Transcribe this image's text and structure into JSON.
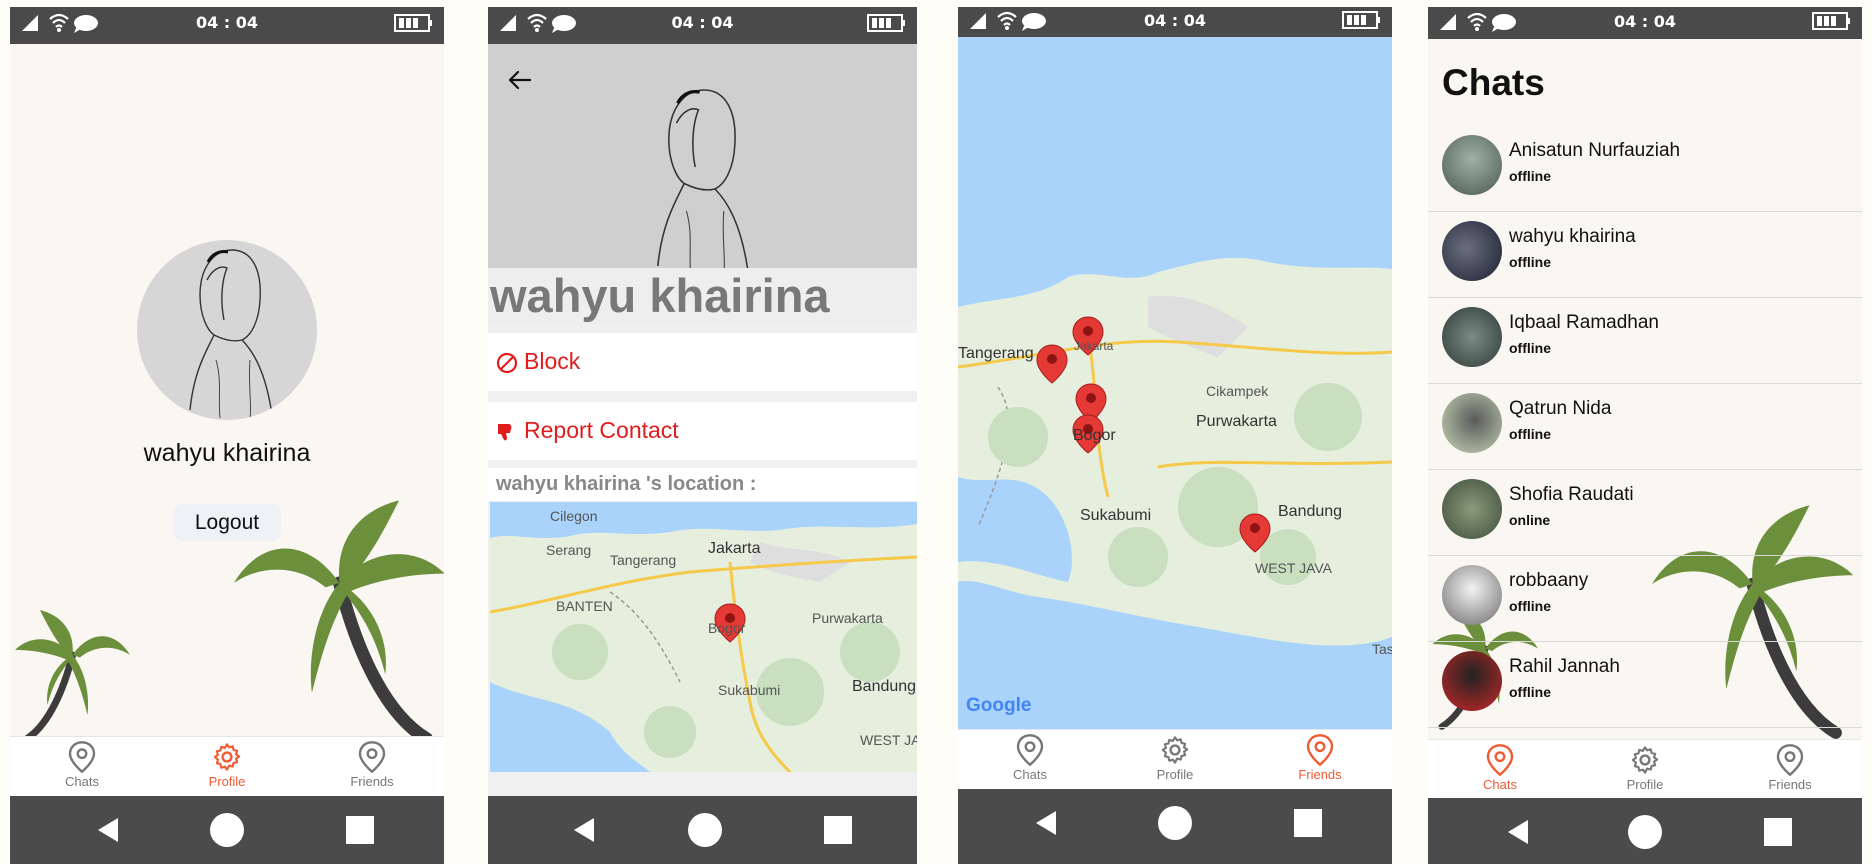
{
  "status_bar": {
    "time": "04 : 04"
  },
  "colors": {
    "accent": "#f05b33",
    "danger": "#e01c1c",
    "status_bar": "#4a4a4a",
    "water": "#aad3fb",
    "land": "#e6eedd"
  },
  "tabs": [
    "Chats",
    "Profile",
    "Friends"
  ],
  "screen1": {
    "user_name": "wahyu khairina",
    "logout_label": "Logout",
    "active_tab": "Profile"
  },
  "screen2": {
    "contact_name": "wahyu khairina",
    "block_label": "Block",
    "report_label": "Report Contact",
    "location_label": "wahyu khairina 's location :",
    "map_labels": [
      "Cilegon",
      "Serang",
      "Tangerang",
      "Jakarta",
      "BANTEN",
      "Bogor",
      "Purwakarta",
      "Sukabumi",
      "Bandung",
      "WEST JA"
    ]
  },
  "screen3": {
    "map_labels": [
      "Tangerang",
      "Jakarta",
      "Cikampek",
      "Purwakarta",
      "Bogor",
      "Sukabumi",
      "Bandung",
      "WEST JAVA",
      "Tas"
    ],
    "map_logo": "Google",
    "active_tab": "Friends"
  },
  "screen4": {
    "title": "Chats",
    "active_tab": "Chats",
    "chats": [
      {
        "name": "Anisatun Nurfauziah",
        "status": "offline"
      },
      {
        "name": "wahyu khairina",
        "status": "offline"
      },
      {
        "name": "Iqbaal Ramadhan",
        "status": "offline"
      },
      {
        "name": "Qatrun Nida",
        "status": "offline"
      },
      {
        "name": "Shofia Raudati",
        "status": "online"
      },
      {
        "name": "robbaany",
        "status": "offline"
      },
      {
        "name": "Rahil Jannah",
        "status": "offline"
      }
    ]
  }
}
